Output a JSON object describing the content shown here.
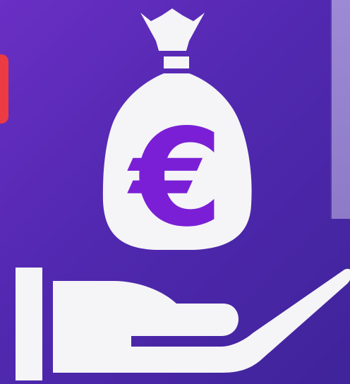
{
  "illustration": {
    "subject": "money-bag-on-hand",
    "currency_symbol": "€",
    "icon_names": [
      "money-bag-icon",
      "euro-icon",
      "hand-icon"
    ]
  },
  "colors": {
    "background_start": "#6a2fc4",
    "background_end": "#3f249a",
    "icon_fill": "#f5f4f7",
    "euro_color": "#7a1fd6",
    "red_tab": "#ec3b43",
    "side_panel": "#9c8ad4"
  }
}
